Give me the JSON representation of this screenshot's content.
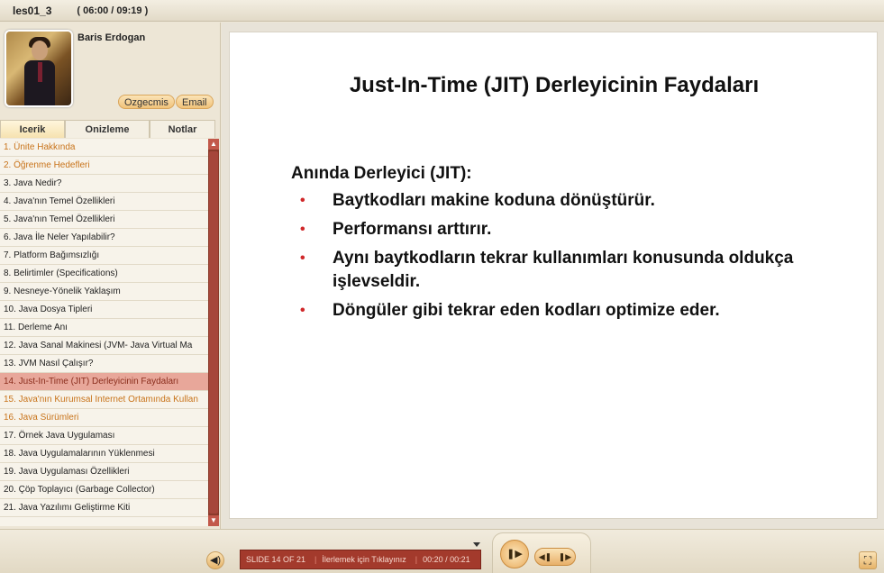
{
  "header": {
    "title": "les01_3",
    "time": "( 06:00 / 09:19 )"
  },
  "presenter": {
    "name": "Baris Erdogan",
    "cv_label": "Ozgecmis",
    "email_label": "Email"
  },
  "tabs": [
    "Icerik",
    "Onizleme",
    "Notlar"
  ],
  "outline": [
    "1. Ünite Hakkında",
    "2. Öğrenme Hedefleri",
    "3. Java Nedir?",
    "4. Java'nın Temel Özellikleri",
    "5. Java'nın Temel Özellikleri",
    "6. Java İle Neler Yapılabilir?",
    "7. Platform Bağımsızlığı",
    "8. Belirtimler (Specifications)",
    "9. Nesneye-Yönelik Yaklaşım",
    "10. Java Dosya Tipleri",
    "11. Derleme Anı",
    "12. Java Sanal Makinesi (JVM- Java Virtual Ma",
    "13. JVM Nasıl Çalışır?",
    "14. Just-In-Time (JIT) Derleyicinin Faydaları",
    "15. Java'nın Kurumsal Internet Ortamında Kullan",
    "16. Java Sürümleri",
    "17. Örnek Java Uygulaması",
    "18. Java Uygulamalarının Yüklenmesi",
    "19. Java Uygulaması Özellikleri",
    "20. Çöp Toplayıcı (Garbage Collector)",
    "21. Java Yazılımı Geliştirme Kiti"
  ],
  "slide": {
    "title": "Just-In-Time (JIT) Derleyicinin Faydaları",
    "subtitle": "Anında Derleyici (JIT):",
    "bullets": [
      "Baytkodları makine koduna dönüştürür.",
      "Performansı arttırır.",
      "Aynı baytkodların tekrar kullanımları konusunda oldukça işlevseldir.",
      "Döngüler gibi tekrar eden kodları optimize eder."
    ]
  },
  "status": {
    "slide": "SLIDE 14 OF 21",
    "hint": "İlerlemek için Tıklayınız",
    "time": "00:20 / 00:21"
  },
  "colors": {
    "accent": "#c8731a",
    "current_bg": "#e8a79a",
    "status_bg": "#a33a2c"
  }
}
